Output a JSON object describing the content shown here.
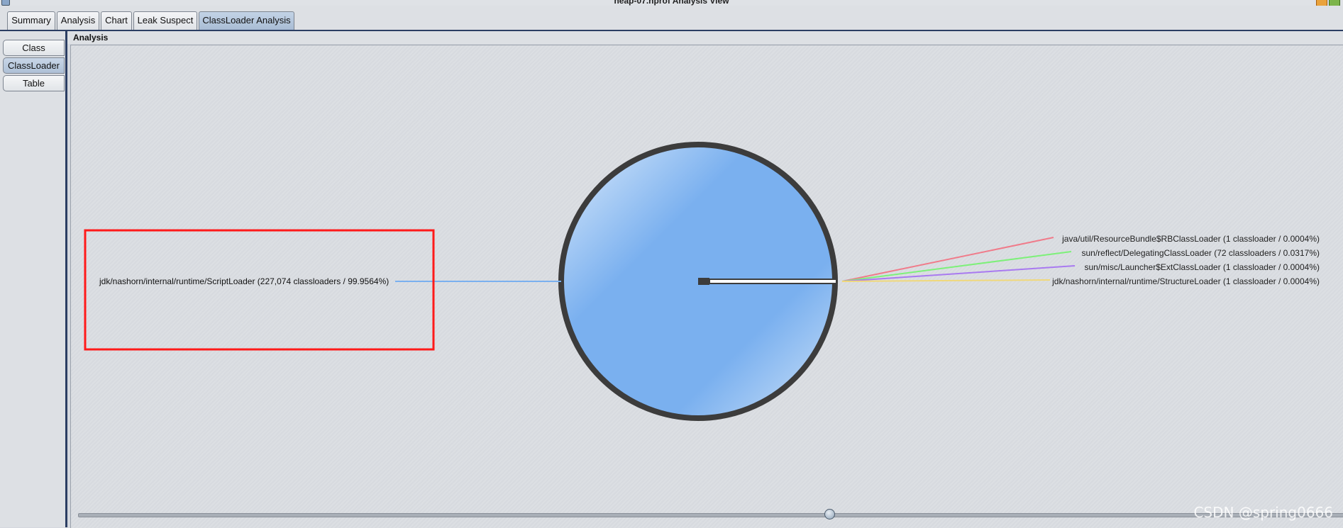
{
  "window": {
    "title": "heap-07.hprof Analysis View"
  },
  "tabs": [
    {
      "label": "Summary",
      "active": false
    },
    {
      "label": "Analysis",
      "active": false
    },
    {
      "label": "Chart",
      "active": false
    },
    {
      "label": "Leak Suspect",
      "active": false
    },
    {
      "label": "ClassLoader Analysis",
      "active": true
    }
  ],
  "sidebar": {
    "items": [
      {
        "label": "Class",
        "active": false
      },
      {
        "label": "ClassLoader",
        "active": true
      },
      {
        "label": "Table",
        "active": false
      }
    ]
  },
  "panel": {
    "title": "Analysis"
  },
  "chart_data": {
    "type": "pie",
    "slices": [
      {
        "label": "jdk/nashorn/internal/runtime/ScriptLoader (227,074 classloaders / 99.9564%)",
        "count": 227074,
        "percent": 99.9564,
        "color": "#7ab0ef"
      },
      {
        "label": "java/util/ResourceBundle$RBClassLoader (1 classloader / 0.0004%)",
        "count": 1,
        "percent": 0.0004,
        "color": "#f07b8a"
      },
      {
        "label": "sun/reflect/DelegatingClassLoader (72 classloaders / 0.0317%)",
        "count": 72,
        "percent": 0.0317,
        "color": "#7ef07a"
      },
      {
        "label": "sun/misc/Launcher$ExtClassLoader (1 classloader / 0.0004%)",
        "count": 1,
        "percent": 0.0004,
        "color": "#a97af0"
      },
      {
        "label": "jdk/nashorn/internal/runtime/StructureLoader (1 classloader / 0.0004%)",
        "count": 1,
        "percent": 0.0004,
        "color": "#f0d87a"
      }
    ]
  },
  "highlight": {
    "color": "#ff1a1a"
  },
  "watermark": "CSDN @spring0666"
}
